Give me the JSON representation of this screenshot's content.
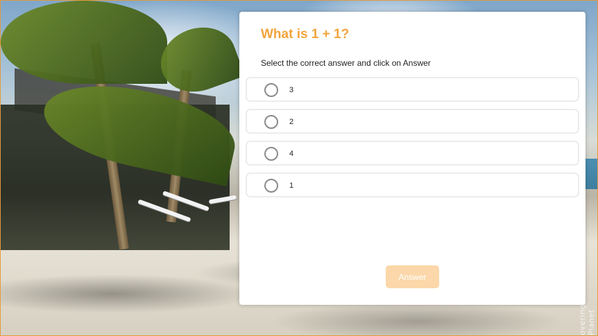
{
  "quiz": {
    "question": "What is 1 + 1?",
    "instruction": "Select the correct answer and click on Answer",
    "options": [
      {
        "label": "3"
      },
      {
        "label": "2"
      },
      {
        "label": "4"
      },
      {
        "label": "1"
      }
    ],
    "answer_label": "Answer"
  },
  "background": {
    "watermark": "overing The Planet"
  },
  "colors": {
    "title": "#f2a43d",
    "answer_button": "#fbd7a9",
    "frame_border": "#e49a3a"
  }
}
